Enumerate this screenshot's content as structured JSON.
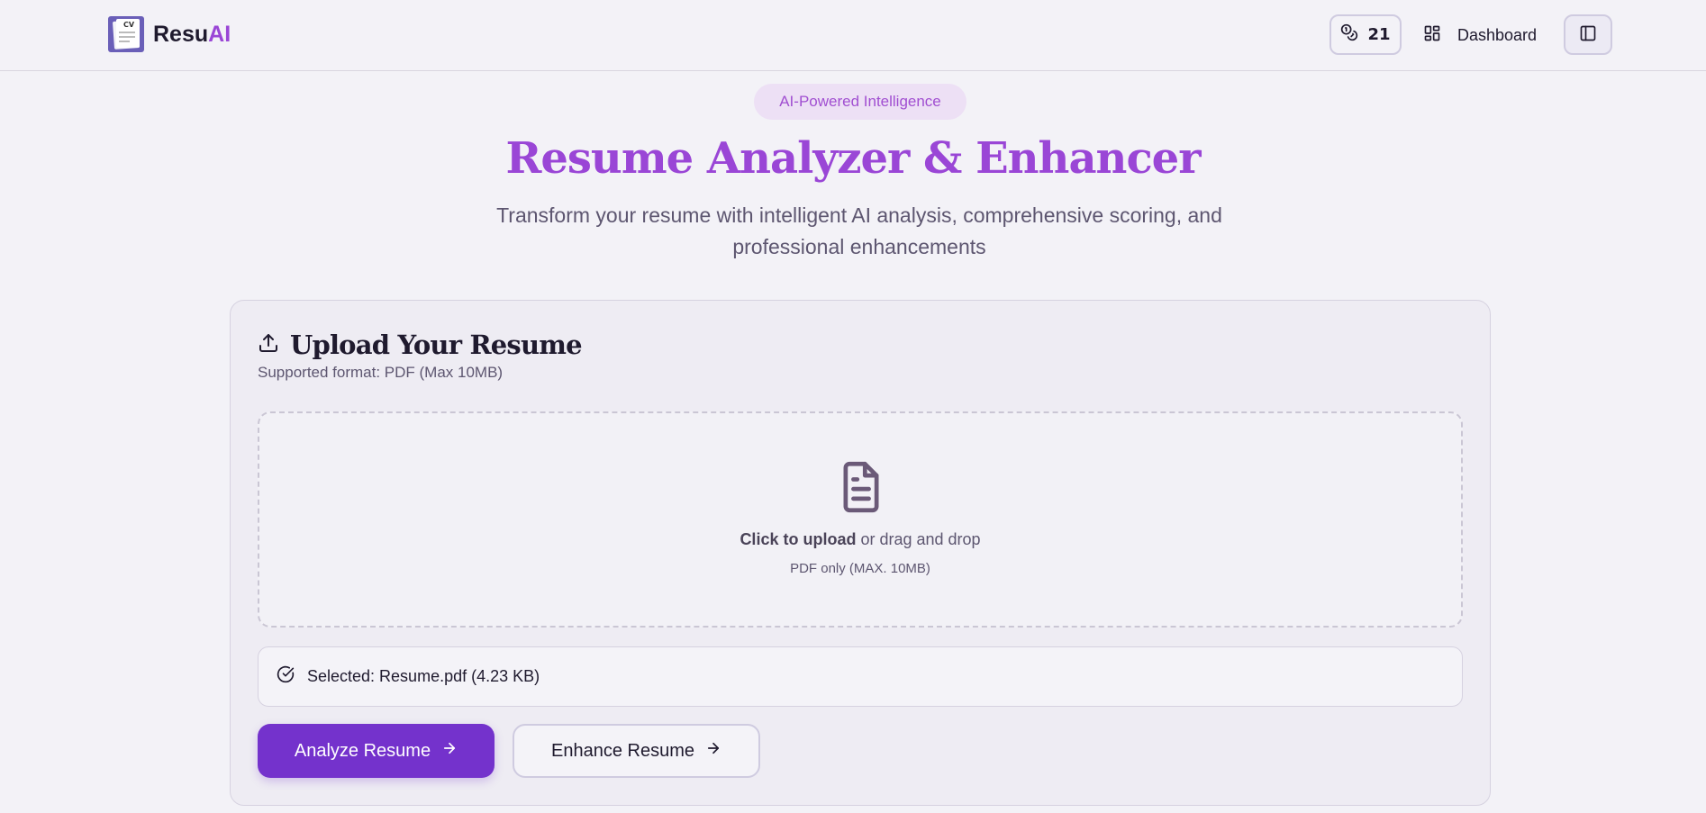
{
  "header": {
    "brand_main": "Resu",
    "brand_accent": "AI",
    "logo_label": "CV",
    "credits": "21",
    "dashboard_label": "Dashboard"
  },
  "hero": {
    "badge": "AI-Powered Intelligence",
    "title": "Resume Analyzer & Enhancer",
    "subtitle": "Transform your resume with intelligent AI analysis, comprehensive scoring, and professional enhancements"
  },
  "upload": {
    "title": "Upload Your Resume",
    "supported": "Supported format: PDF (Max 10MB)",
    "click_text": "Click to upload",
    "drag_text": " or drag and drop",
    "hint": "PDF only (MAX. 10MB)",
    "selected": "Selected: Resume.pdf (4.23 KB)"
  },
  "actions": {
    "analyze": "Analyze Resume",
    "enhance": "Enhance Resume"
  },
  "colors": {
    "accent": "#9a46d6",
    "primary_button": "#7432cc",
    "badge_bg": "#ede0f5"
  },
  "icons": [
    "logo-icon",
    "coins-icon",
    "dashboard-grid-icon",
    "sidebar-toggle-icon",
    "upload-icon",
    "document-icon",
    "check-circle-icon",
    "arrow-right-icon"
  ]
}
